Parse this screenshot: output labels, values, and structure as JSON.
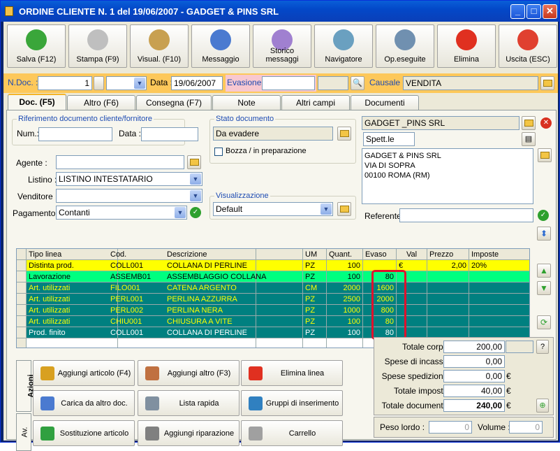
{
  "window": {
    "title": "ORDINE CLIENTE N. 1   del 19/06/2007 - GADGET & PINS SRL",
    "min": "_",
    "max": "□",
    "close": "✕"
  },
  "toolbar": [
    {
      "name": "save-button",
      "icon": "check-icon",
      "label": "Salva (F12)",
      "color": "#3aa63a"
    },
    {
      "name": "print-button",
      "icon": "printer-icon",
      "label": "Stampa (F9)",
      "color": "#bfbfbf"
    },
    {
      "name": "preview-button",
      "icon": "wand-icon",
      "label": "Visual. (F10)",
      "color": "#c8a050"
    },
    {
      "name": "message-button",
      "icon": "pen-icon",
      "label": "Messaggio",
      "color": "#4a7ad0"
    },
    {
      "name": "history-button",
      "icon": "search-doc-icon",
      "label": "Storico messaggi",
      "color": "#a080d0"
    },
    {
      "name": "navigator-button",
      "icon": "compass-icon",
      "label": "Navigatore",
      "color": "#6aa0c0"
    },
    {
      "name": "ops-button",
      "icon": "gears-icon",
      "label": "Op.eseguite",
      "color": "#7090b0"
    },
    {
      "name": "delete-button",
      "icon": "x-icon",
      "label": "Elimina",
      "color": "#e03020"
    },
    {
      "name": "exit-button",
      "icon": "exit-icon",
      "label": "Uscita (ESC)",
      "color": "#e04030"
    }
  ],
  "docbar": {
    "ndoc_label": "N.Doc. :",
    "ndoc_value": "1",
    "data_label": "Data :",
    "data_value": "19/06/2007",
    "evasione_label": "Evasione:",
    "evasione_value": "",
    "causale_label": "Causale :",
    "causale_value": "VENDITA"
  },
  "tabs": [
    "Doc. (F5)",
    "Altro (F6)",
    "Consegna (F7)",
    "Note",
    "Altri campi",
    "Documenti"
  ],
  "rif": {
    "title": "Riferimento documento cliente/fornitore",
    "num_label": "Num.:",
    "num_value": "",
    "data_label": "Data :",
    "data_value": ""
  },
  "stato": {
    "title": "Stato documento",
    "value": "Da evadere",
    "bozza_label": "Bozza / in preparazione"
  },
  "left": {
    "agente_label": "Agente :",
    "agente_value": "",
    "listino_label": "Listino :",
    "listino_value": "LISTINO INTESTATARIO",
    "venditore_label": "Venditore :",
    "venditore_value": "",
    "pagamento_label": "Pagamento :",
    "pagamento_value": "Contanti"
  },
  "visual": {
    "title": "Visualizzazione",
    "value": "Default"
  },
  "cliente": {
    "name": "GADGET _PINS SRL",
    "spett": "Spett.le",
    "addr1": "GADGET & PINS SRL",
    "addr2": "VIA DI SOPRA",
    "addr3": "00100 ROMA (RM)",
    "referente_label": "Referente",
    "referente_value": ""
  },
  "grid": {
    "headers": [
      "Tipo linea",
      "Cod.",
      "Descrizione",
      "UM",
      "Quant.",
      "Evaso",
      "Val",
      "Prezzo",
      "Imposte"
    ],
    "rows": [
      [
        "Distinta prod.",
        "COLL001",
        "COLLANA DI PERLINE",
        "PZ",
        "100",
        "",
        "€",
        "2,00",
        "20%"
      ],
      [
        "Lavorazione",
        "ASSEMB01",
        "ASSEMBLAGGIO COLLANA",
        "PZ",
        "100",
        "80",
        "",
        "",
        ""
      ],
      [
        "Art. utilizzati",
        "FILO001",
        "CATENA ARGENTO",
        "CM",
        "2000",
        "1600",
        "",
        "",
        ""
      ],
      [
        "Art. utilizzati",
        "PERL001",
        "PERLINA AZZURRA",
        "PZ",
        "2500",
        "2000",
        "",
        "",
        ""
      ],
      [
        "Art. utilizzati",
        "PERL002",
        "PERLINA NERA",
        "PZ",
        "1000",
        "800",
        "",
        "",
        ""
      ],
      [
        "Art. utilizzati",
        "CHIU001",
        "CHIUSURA A VITE",
        "PZ",
        "100",
        "80",
        "",
        "",
        ""
      ],
      [
        "Prod. finito",
        "COLL001",
        "COLLANA DI PERLINE",
        "PZ",
        "100",
        "80",
        "",
        "",
        ""
      ],
      [
        "",
        "",
        "",
        "",
        "",
        "",
        "",
        "",
        ""
      ]
    ],
    "row_colors": [
      "#ffff00",
      "#00ff80",
      "#008080",
      "#008080",
      "#008080",
      "#008080",
      "#008080",
      "#ffffff"
    ],
    "row_text": [
      "#000000",
      "#000000",
      "#ffff00",
      "#ffff00",
      "#ffff00",
      "#ffff00",
      "#ffffff",
      "#000000"
    ]
  },
  "azioni": {
    "tab_label": "Azioni",
    "tab2_label": "Av.",
    "buttons": [
      {
        "label": "Aggiungi articolo (F4)",
        "icon": "box-add-icon",
        "color": "#d8a020"
      },
      {
        "label": "Aggiungi altro (F3)",
        "icon": "grid-add-icon",
        "color": "#c07040"
      },
      {
        "label": "Elimina linea",
        "icon": "x-icon",
        "color": "#e03020"
      },
      {
        "label": "Carica da altro doc.",
        "icon": "doc-load-icon",
        "color": "#4a7ad0"
      },
      {
        "label": "Lista rapida",
        "icon": "list-icon",
        "color": "#8090a0"
      },
      {
        "label": "Gruppi di inserimento",
        "icon": "group-icon",
        "color": "#3080c0"
      },
      {
        "label": "Sostituzione articolo",
        "icon": "swap-icon",
        "color": "#30a040"
      },
      {
        "label": "Aggiungi riparazione",
        "icon": "wrench-icon",
        "color": "#808080"
      },
      {
        "label": "Carrello",
        "icon": "cart-icon",
        "color": "#a0a0a0"
      }
    ]
  },
  "totals": {
    "corpo_label": "Totale corpo :",
    "corpo_value": "200,00",
    "help": "?",
    "incasso_label": "Spese di incasso :",
    "incasso_value": "0,00",
    "spedizione_label": "Spese spedizione :",
    "spedizione_value": "0,00",
    "cur": "€",
    "imposte_label": "Totale imposte :",
    "imposte_value": "40,00",
    "documento_label": "Totale documento :",
    "documento_value": "240,00"
  },
  "weight": {
    "peso_label": "Peso lordo :",
    "peso_value": "0",
    "volume_label": "Volume :",
    "volume_value": "0"
  }
}
